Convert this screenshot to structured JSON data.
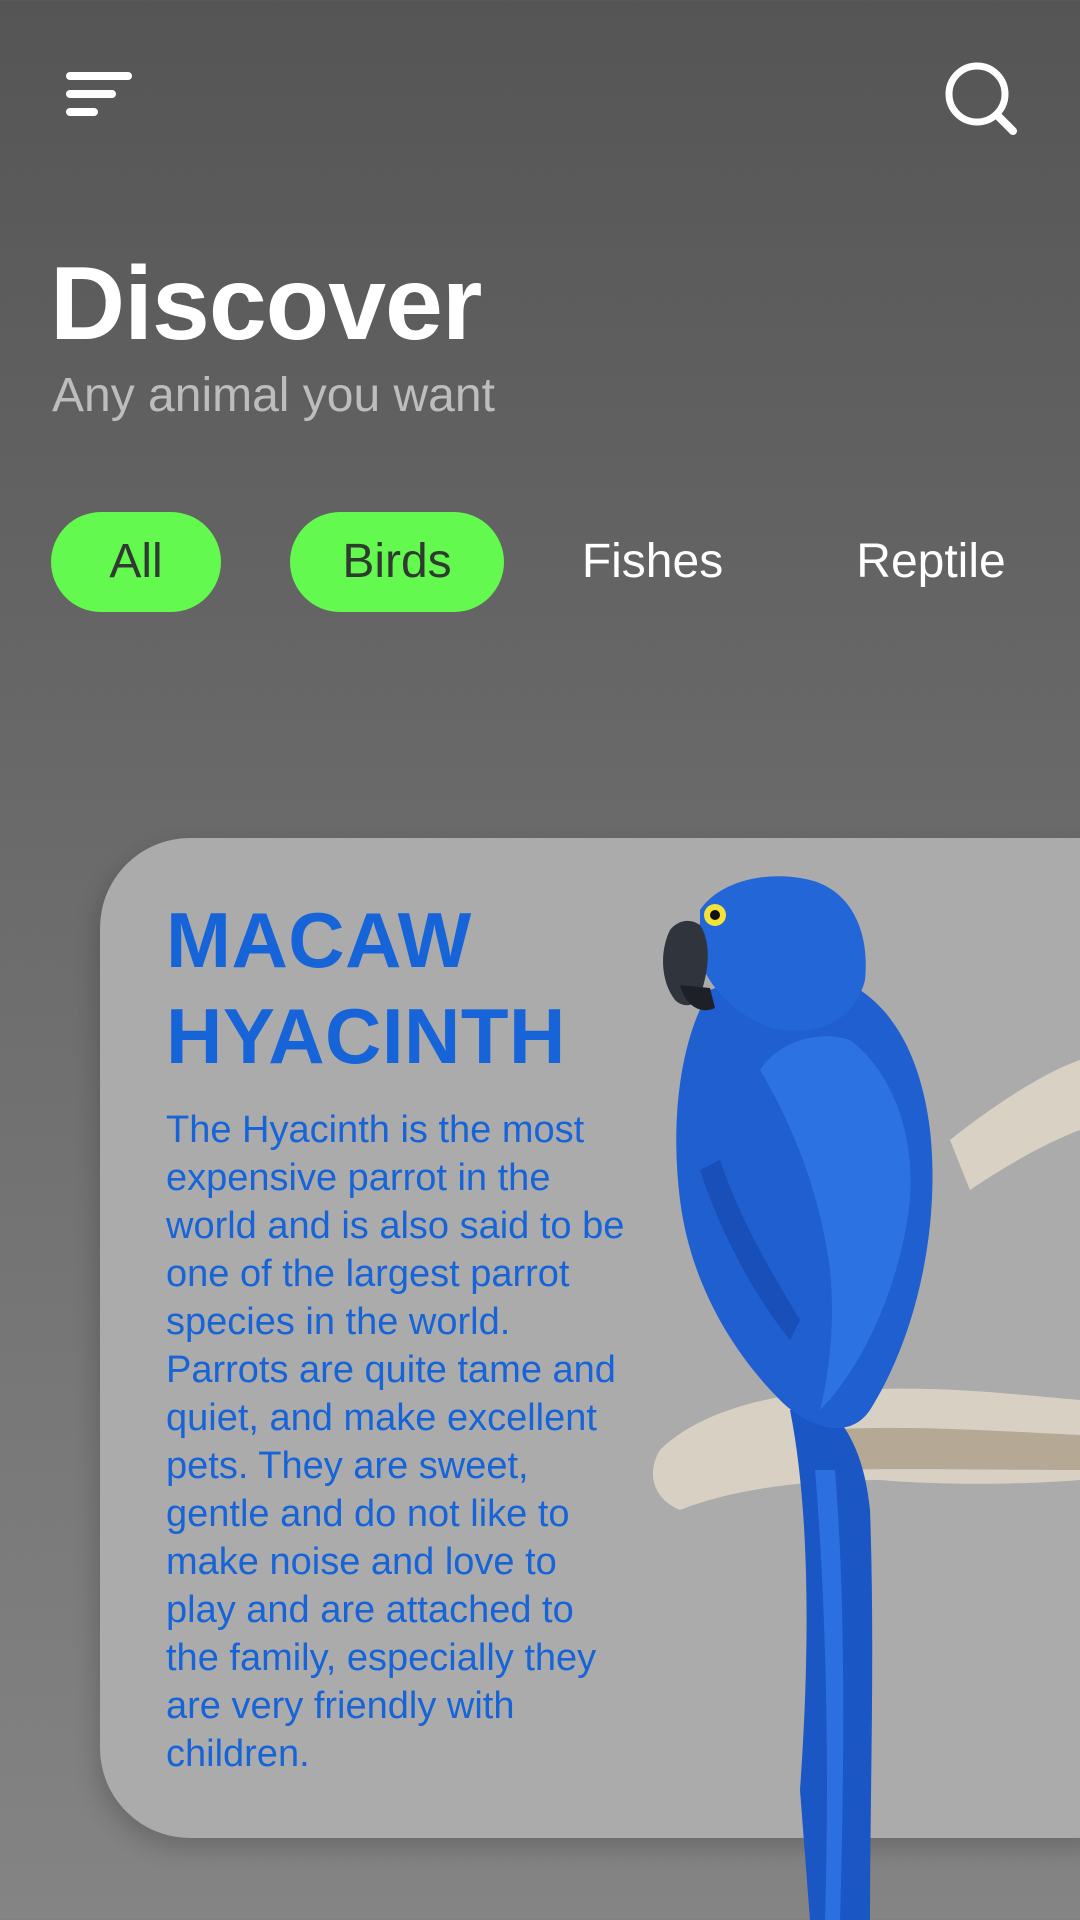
{
  "header": {
    "menu_icon": "menu-icon",
    "search_icon": "search-icon",
    "title": "Discover",
    "subtitle": "Any animal you want"
  },
  "categories": [
    {
      "label": "All",
      "selected": true
    },
    {
      "label": "Birds",
      "selected": true
    },
    {
      "label": "Fishes",
      "selected": false
    },
    {
      "label": "Reptile",
      "selected": false
    }
  ],
  "card": {
    "title": "MACAW HYACINTH",
    "description": "The Hyacinth is the most expensive parrot in the world and is also said to be one of the largest parrot species in the world. Parrots are quite tame and quiet, and make excellent pets. They are sweet, gentle and do not like to make noise and love to play and are attached to the family, especially they are very friendly with children.",
    "image": "blue-macaw-parrot-image"
  },
  "colors": {
    "accent": "#63f94e",
    "card_text": "#1664d8",
    "card_bg": "#ababab",
    "bird_blue": "#1f5fd0"
  }
}
